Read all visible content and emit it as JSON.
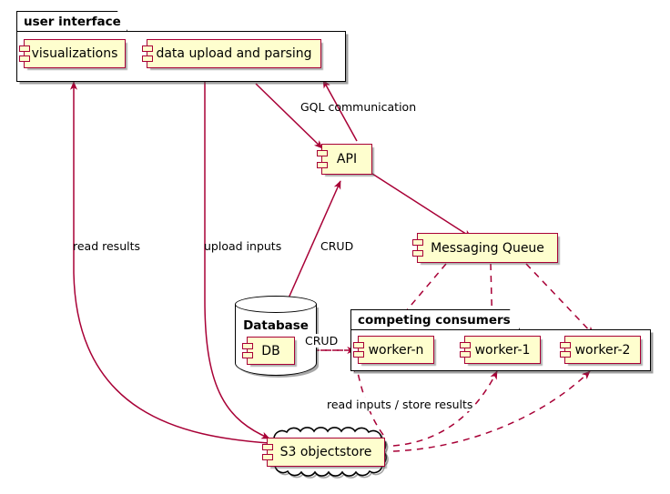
{
  "diagram": {
    "title": "System architecture component diagram",
    "colors": {
      "component_fill": "#FEFECE",
      "component_border": "#A80036",
      "arrow": "#A80036",
      "package_border": "#000000",
      "background": "#FFFFFF"
    }
  },
  "packages": [
    {
      "id": "ui",
      "label": "user interface"
    },
    {
      "id": "consumers",
      "label": "competing consumers"
    }
  ],
  "components": [
    {
      "id": "visualizations",
      "label": "visualizations"
    },
    {
      "id": "upload",
      "label": "data upload and parsing"
    },
    {
      "id": "api",
      "label": "API"
    },
    {
      "id": "queue",
      "label": "Messaging Queue"
    },
    {
      "id": "worker_n",
      "label": "worker-n"
    },
    {
      "id": "worker_1",
      "label": "worker-1"
    },
    {
      "id": "worker_2",
      "label": "worker-2"
    },
    {
      "id": "db",
      "label": "DB"
    },
    {
      "id": "s3",
      "label": "S3 objectstore"
    }
  ],
  "database": {
    "label": "Database"
  },
  "cloud": {
    "label": "S3 objectstore"
  },
  "edges": [
    {
      "id": "e_gql",
      "label": "GQL communication",
      "from": "upload",
      "to": "api",
      "style": "solid"
    },
    {
      "id": "e_crud_api",
      "label": "CRUD",
      "from": "db",
      "to": "api",
      "style": "solid"
    },
    {
      "id": "e_read",
      "label": "read results",
      "from": "s3",
      "to": "visualizations",
      "style": "solid"
    },
    {
      "id": "e_upload",
      "label": "upload inputs",
      "from": "upload",
      "to": "s3",
      "style": "solid"
    },
    {
      "id": "e_api_mq",
      "label": "",
      "from": "api",
      "to": "queue",
      "style": "solid"
    },
    {
      "id": "e_mq_wn",
      "label": "",
      "from": "queue",
      "to": "worker_n",
      "style": "dashed"
    },
    {
      "id": "e_mq_w1",
      "label": "",
      "from": "queue",
      "to": "worker_1",
      "style": "dashed"
    },
    {
      "id": "e_mq_w2",
      "label": "",
      "from": "queue",
      "to": "worker_2",
      "style": "dashed"
    },
    {
      "id": "e_crud_db",
      "label": "CRUD",
      "from": "worker_n",
      "to": "db",
      "style": "dashed"
    },
    {
      "id": "e_store",
      "label": "read inputs / store results",
      "from": "s3",
      "to": "worker_n",
      "style": "dashed"
    }
  ],
  "edge_labels": {
    "gql": "GQL communication",
    "crud_api": "CRUD",
    "crud_db": "CRUD",
    "read_results": "read results",
    "upload_inputs": "upload inputs",
    "read_store": "read inputs / store results"
  }
}
